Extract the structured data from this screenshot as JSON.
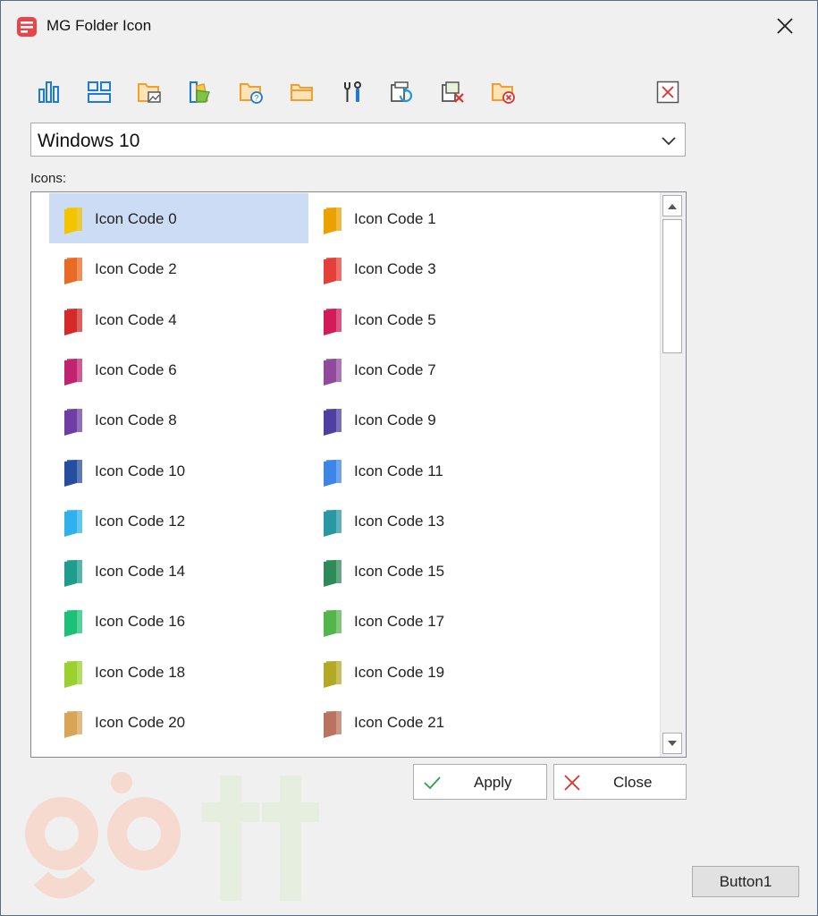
{
  "window": {
    "title": "MG Folder Icon"
  },
  "toolbar": {
    "buttons": [
      {
        "icon": "bar-chart-icon",
        "color": "#1e7ad6"
      },
      {
        "icon": "layout-grid-icon",
        "color": "#1e7ad6"
      },
      {
        "icon": "folder-image-icon",
        "color": "#f0a030"
      },
      {
        "icon": "color-palette-icon",
        "color": "#1e7ad6"
      },
      {
        "icon": "folder-help-icon",
        "color": "#f0a030"
      },
      {
        "icon": "folder-open-icon",
        "color": "#f0a030"
      },
      {
        "icon": "tools-icon",
        "color": "#333333"
      },
      {
        "icon": "refresh-icon",
        "color": "#1e9ad6"
      },
      {
        "icon": "remove-icon",
        "color": "#e03030"
      },
      {
        "icon": "folder-delete-icon",
        "color": "#f0a030"
      }
    ],
    "close_icon": "close-icon"
  },
  "style_select": {
    "value": "Windows 10"
  },
  "icons_label": "Icons:",
  "icons": [
    {
      "label": "Icon Code 0",
      "color": "#f2c500",
      "selected": true
    },
    {
      "label": "Icon Code 1",
      "color": "#eba200"
    },
    {
      "label": "Icon Code 2",
      "color": "#e86a25"
    },
    {
      "label": "Icon Code 3",
      "color": "#e53f3a"
    },
    {
      "label": "Icon Code 4",
      "color": "#d42a2a"
    },
    {
      "label": "Icon Code 5",
      "color": "#d41b5a"
    },
    {
      "label": "Icon Code 6",
      "color": "#c1246f"
    },
    {
      "label": "Icon Code 7",
      "color": "#8f4a9c"
    },
    {
      "label": "Icon Code 8",
      "color": "#6e3ea4"
    },
    {
      "label": "Icon Code 9",
      "color": "#4f3fa1"
    },
    {
      "label": "Icon Code 10",
      "color": "#254e9e"
    },
    {
      "label": "Icon Code 11",
      "color": "#3d86e6"
    },
    {
      "label": "Icon Code 12",
      "color": "#31b1ec"
    },
    {
      "label": "Icon Code 13",
      "color": "#2a97a4"
    },
    {
      "label": "Icon Code 14",
      "color": "#1f9c8e"
    },
    {
      "label": "Icon Code 15",
      "color": "#2f8a5a"
    },
    {
      "label": "Icon Code 16",
      "color": "#1cc177"
    },
    {
      "label": "Icon Code 17",
      "color": "#54b54c"
    },
    {
      "label": "Icon Code 18",
      "color": "#9bd12f"
    },
    {
      "label": "Icon Code 19",
      "color": "#b3a925"
    },
    {
      "label": "Icon Code 20",
      "color": "#d7a555"
    },
    {
      "label": "Icon Code 21",
      "color": "#b9735f"
    }
  ],
  "buttons": {
    "apply": "Apply",
    "close": "Close",
    "button1": "Button1"
  }
}
